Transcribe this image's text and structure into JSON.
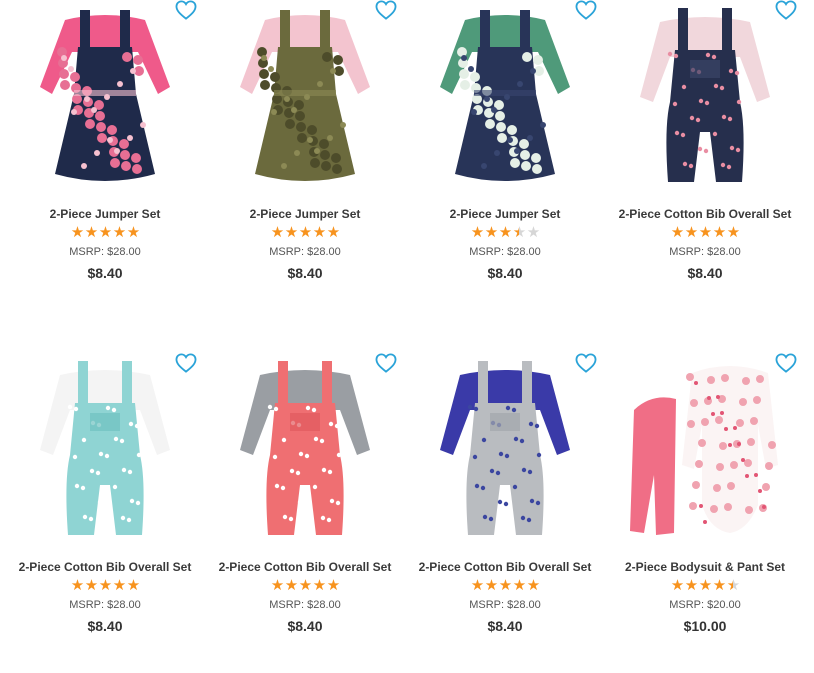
{
  "colors": {
    "star_filled": "#f7931e",
    "star_empty": "#d6d6d6",
    "heart": "#2aa3d8"
  },
  "products": [
    {
      "name": "2-Piece Jumper Set",
      "rating": 5,
      "msrp": "MSRP: $28.00",
      "price": "$8.40",
      "image": {
        "kind": "jumper",
        "shirt": "#ef5a8a",
        "body": "#1f2a4a",
        "pattern": "#e76f94",
        "accent": "#f6c1d0"
      }
    },
    {
      "name": "2-Piece Jumper Set",
      "rating": 5,
      "msrp": "MSRP: $28.00",
      "price": "$8.40",
      "image": {
        "kind": "jumper",
        "shirt": "#f3c4cf",
        "body": "#6b6a3d",
        "pattern": "#4d4c2a",
        "accent": "#8c8a55"
      }
    },
    {
      "name": "2-Piece Jumper Set",
      "rating": 3.5,
      "msrp": "MSRP: $28.00",
      "price": "$8.40",
      "image": {
        "kind": "jumper",
        "shirt": "#4f9a7a",
        "body": "#283458",
        "pattern": "#e5efe6",
        "accent": "#384670"
      }
    },
    {
      "name": "2-Piece Cotton Bib Overall Set",
      "rating": 5,
      "msrp": "MSRP: $28.00",
      "price": "$8.40",
      "image": {
        "kind": "overall",
        "shirt": "#f1d7dc",
        "body": "#262f4d",
        "pattern": "#e98ea3",
        "accent": "#3a4566"
      }
    },
    {
      "name": "2-Piece Cotton Bib Overall Set",
      "rating": 5,
      "msrp": "MSRP: $28.00",
      "price": "$8.40",
      "image": {
        "kind": "overall",
        "shirt": "#f4f4f4",
        "body": "#8fd4d3",
        "pattern": "#ffffff",
        "accent": "#6fc2c1"
      }
    },
    {
      "name": "2-Piece Cotton Bib Overall Set",
      "rating": 5,
      "msrp": "MSRP: $28.00",
      "price": "$8.40",
      "image": {
        "kind": "overall",
        "shirt": "#9a9ea3",
        "body": "#ef6f72",
        "pattern": "#ffffff",
        "accent": "#e15a5e"
      }
    },
    {
      "name": "2-Piece Cotton Bib Overall Set",
      "rating": 5,
      "msrp": "MSRP: $28.00",
      "price": "$8.40",
      "image": {
        "kind": "overall",
        "shirt": "#3a3aa8",
        "body": "#b9bcc0",
        "pattern": "#3b46a0",
        "accent": "#a3a7ad"
      }
    },
    {
      "name": "2-Piece Bodysuit & Pant Set",
      "rating": 4.5,
      "msrp": "MSRP: $20.00",
      "price": "$10.00",
      "image": {
        "kind": "bodysuit",
        "shirt": "#fbf4f4",
        "body": "#f06e86",
        "pattern": "#f0a3b0",
        "accent": "#e25574"
      }
    }
  ]
}
